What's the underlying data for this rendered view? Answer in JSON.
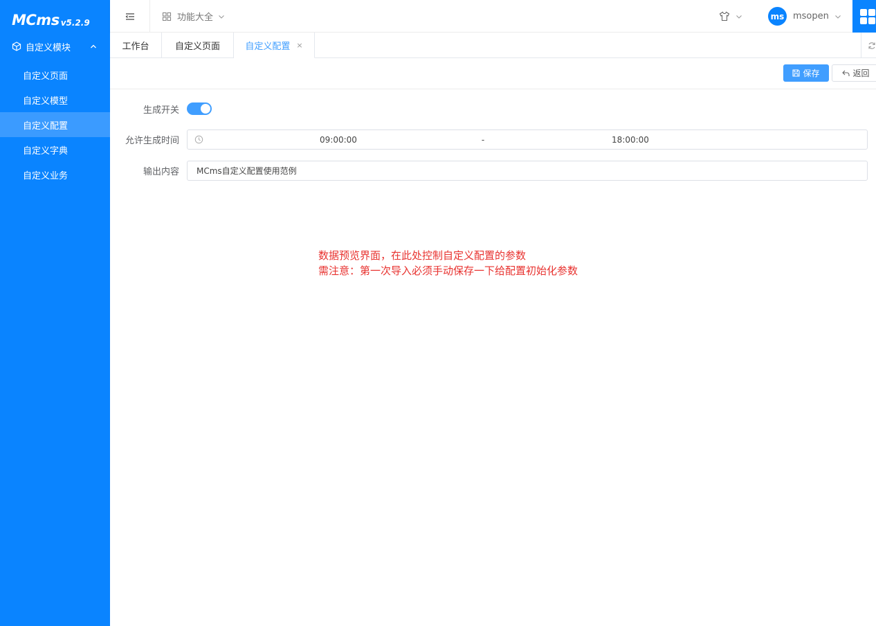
{
  "brand": {
    "name": "MCms",
    "version": "v5.2.9"
  },
  "sidebar": {
    "parent_label": "自定义模块",
    "items": [
      {
        "label": "自定义页面",
        "active": false
      },
      {
        "label": "自定义模型",
        "active": false
      },
      {
        "label": "自定义配置",
        "active": true
      },
      {
        "label": "自定义字典",
        "active": false
      },
      {
        "label": "自定义业务",
        "active": false
      }
    ]
  },
  "header": {
    "function_menu_label": "功能大全",
    "user": {
      "avatar_text": "ms",
      "name": "msopen"
    }
  },
  "tabs": [
    {
      "label": "工作台",
      "active": false,
      "closable": false
    },
    {
      "label": "自定义页面",
      "active": false,
      "closable": false
    },
    {
      "label": "自定义配置",
      "active": true,
      "closable": true,
      "close_glyph": "×"
    }
  ],
  "toolbar": {
    "save_label": "保存",
    "back_label": "返回"
  },
  "form": {
    "switch": {
      "label": "生成开关",
      "on": true
    },
    "time_range": {
      "label": "允许生成时间",
      "start": "09:00:00",
      "separator": "-",
      "end": "18:00:00"
    },
    "output": {
      "label": "输出内容",
      "value": "MCms自定义配置使用范例"
    }
  },
  "notice": {
    "line1": "数据预览界面，在此处控制自定义配置的参数",
    "line2": "需注意：第一次导入必须手动保存一下给配置初始化参数"
  },
  "colors": {
    "brand": "#0a84ff",
    "primary": "#409eff",
    "notice": "#e8322f"
  }
}
